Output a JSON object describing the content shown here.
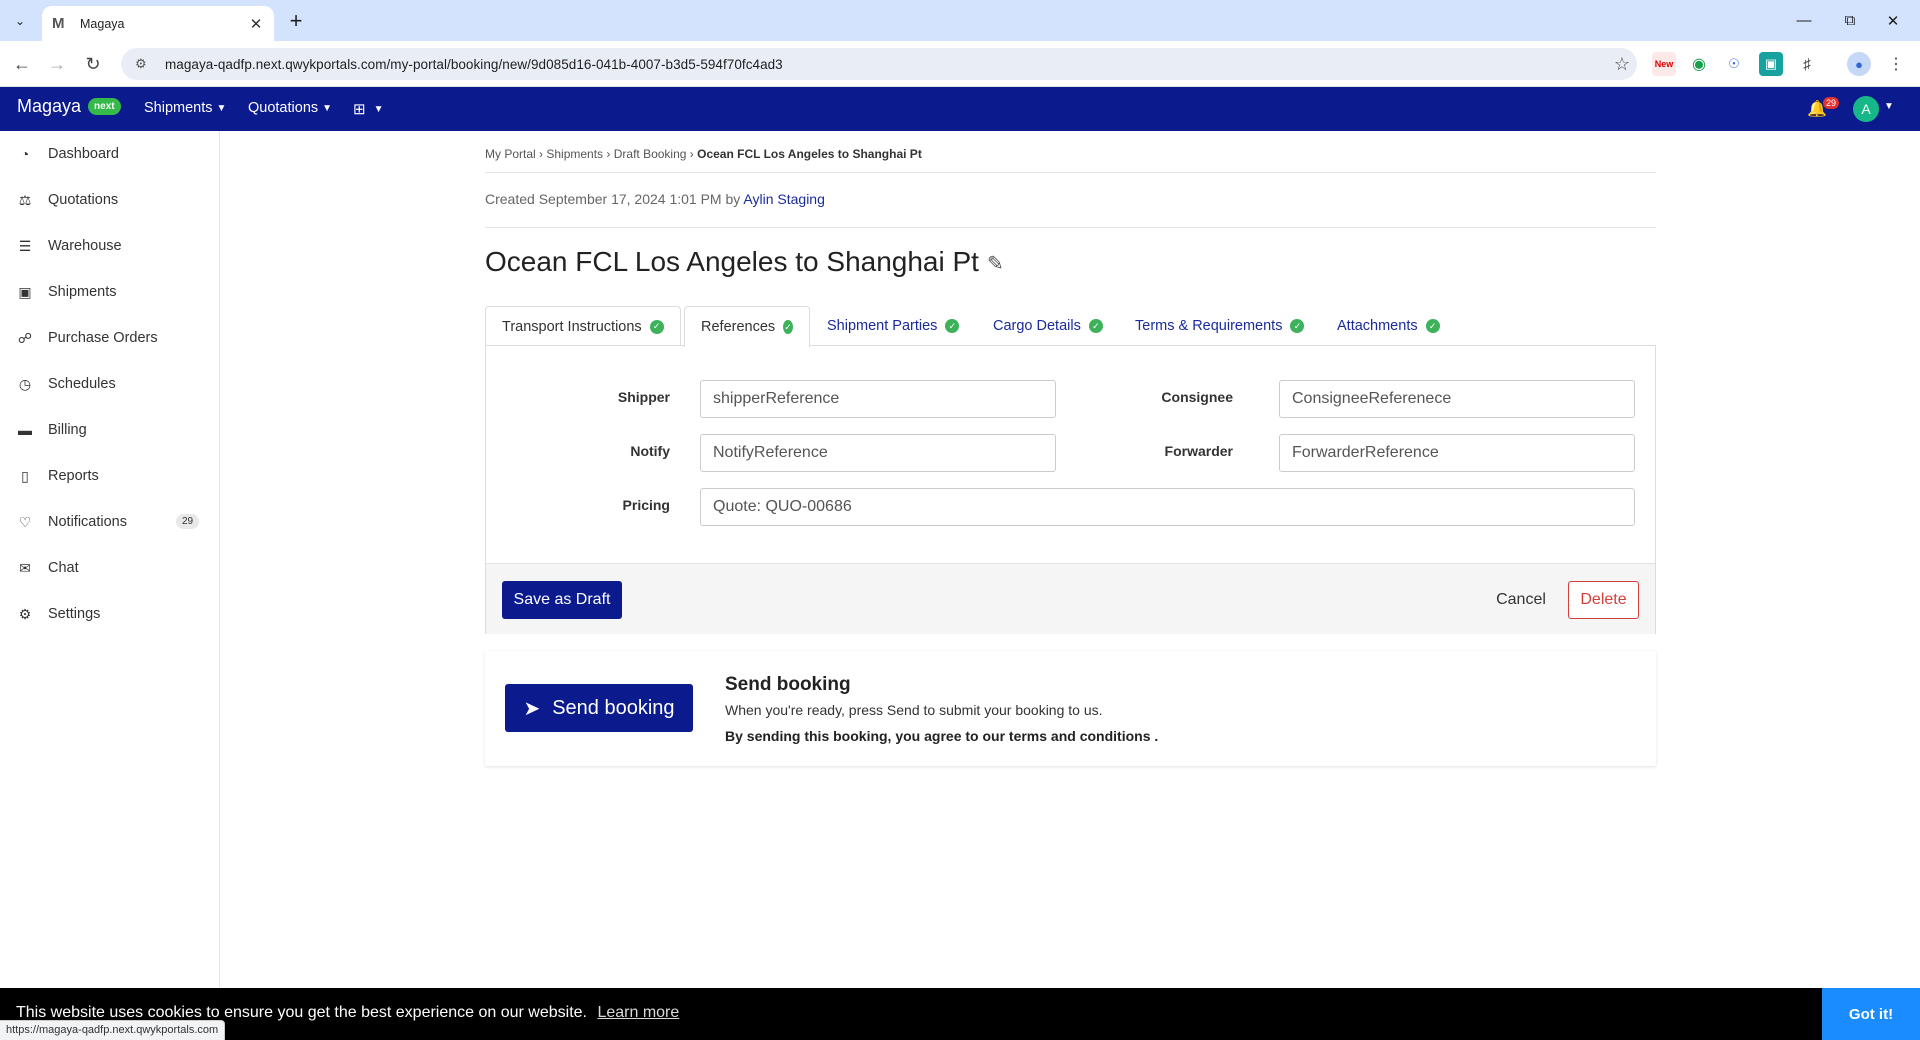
{
  "browser": {
    "tab_title": "Magaya",
    "url": "magaya-qadfp.next.qwykportals.com/my-portal/booking/new/9d085d16-041b-4007-b3d5-594f70fc4ad3",
    "status_url": "https://magaya-qadfp.next.qwykportals.com"
  },
  "appbar": {
    "brand": "Magaya",
    "brand_badge": "next",
    "nav": [
      "Shipments",
      "Quotations"
    ],
    "notification_count": "29",
    "avatar_initial": "A"
  },
  "sidebar": {
    "items": [
      {
        "label": "Dashboard",
        "icon": "gauge-icon"
      },
      {
        "label": "Quotations",
        "icon": "scale-icon"
      },
      {
        "label": "Warehouse",
        "icon": "warehouse-icon"
      },
      {
        "label": "Shipments",
        "icon": "box-icon"
      },
      {
        "label": "Purchase Orders",
        "icon": "cart-icon"
      },
      {
        "label": "Schedules",
        "icon": "clock-icon"
      },
      {
        "label": "Billing",
        "icon": "credit-card-icon"
      },
      {
        "label": "Reports",
        "icon": "bar-chart-icon"
      },
      {
        "label": "Notifications",
        "icon": "bell-icon",
        "count": "29"
      },
      {
        "label": "Chat",
        "icon": "chat-icon"
      },
      {
        "label": "Settings",
        "icon": "gear-icon"
      }
    ]
  },
  "breadcrumb": {
    "items": [
      "My Portal",
      "Shipments",
      "Draft Booking"
    ],
    "current": "Ocean FCL Los Angeles to Shanghai Pt"
  },
  "created": {
    "text": "Created September 17, 2024 1:01 PM by",
    "author": "Aylin Staging"
  },
  "page_title": "Ocean FCL Los Angeles to Shanghai Pt",
  "tabs": [
    "Transport Instructions",
    "References",
    "Shipment Parties",
    "Cargo Details",
    "Terms & Requirements",
    "Attachments"
  ],
  "references": {
    "shipper_label": "Shipper",
    "shipper_value": "shipperReference",
    "consignee_label": "Consignee",
    "consignee_value": "ConsigneeReferenece",
    "notify_label": "Notify",
    "notify_value": "NotifyReference",
    "forwarder_label": "Forwarder",
    "forwarder_value": "ForwarderReference",
    "pricing_label": "Pricing",
    "pricing_value": "Quote: QUO-00686"
  },
  "actions": {
    "save_draft": "Save as Draft",
    "cancel": "Cancel",
    "delete": "Delete"
  },
  "send": {
    "button": "Send booking",
    "heading": "Send booking",
    "text": "When you're ready, press Send to submit your booking to us.",
    "terms": "By sending this booking, you agree to our terms and conditions ."
  },
  "cookie": {
    "message": "This website uses cookies to ensure you get the best experience on our website.",
    "learn_more": "Learn more",
    "button": "Got it!"
  },
  "colors": {
    "brand_navy": "#0b1a8d",
    "success_green": "#3db25a",
    "danger_red": "#d43f3a",
    "cookie_blue": "#1a8cff"
  }
}
